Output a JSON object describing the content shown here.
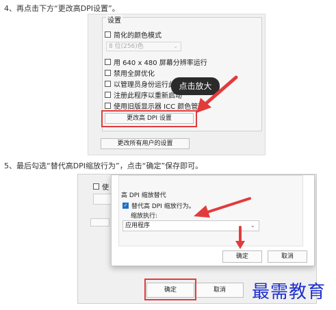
{
  "step4": {
    "text": "4、再点击下方“更改高DPI设置”。"
  },
  "step5": {
    "text": "5、最后勾选“替代高DPI缩放行为”，点击“确定”保存即可。"
  },
  "shot1": {
    "group_title": "设置",
    "options": [
      {
        "label": "简化的颜色模式",
        "checked": false
      },
      {
        "label": "用 640 x 480 屏幕分辨率运行",
        "checked": false
      },
      {
        "label": "禁用全屏优化",
        "checked": false
      },
      {
        "label": "以管理员身份运行此程序",
        "checked": false
      },
      {
        "label": "注册此程序以重新启动",
        "checked": false
      },
      {
        "label": "使用旧版显示器 ICC 颜色管理",
        "checked": false
      }
    ],
    "color_combo_value": "8 位(256)色",
    "change_dpi_button": "更改高 DPI 设置",
    "change_all_users_button": "更改所有用户的设置",
    "tooltip": "点击放大"
  },
  "shot2": {
    "back_checkbox_label": "使",
    "dialog": {
      "section_title": "高 DPI 缩放替代",
      "override_label": "替代高 DPI 缩放行为。",
      "override_checked": true,
      "performed_by_label": "缩放执行:",
      "combo_value": "应用程序",
      "ok_label": "确定",
      "cancel_label": "取消"
    },
    "ok_label": "确定",
    "cancel_label": "取消"
  },
  "watermark": "最需教育",
  "colors": {
    "highlight_red": "#e23b3b",
    "checkbox_blue": "#1f6fc5",
    "watermark_blue": "#1c2fd0"
  }
}
